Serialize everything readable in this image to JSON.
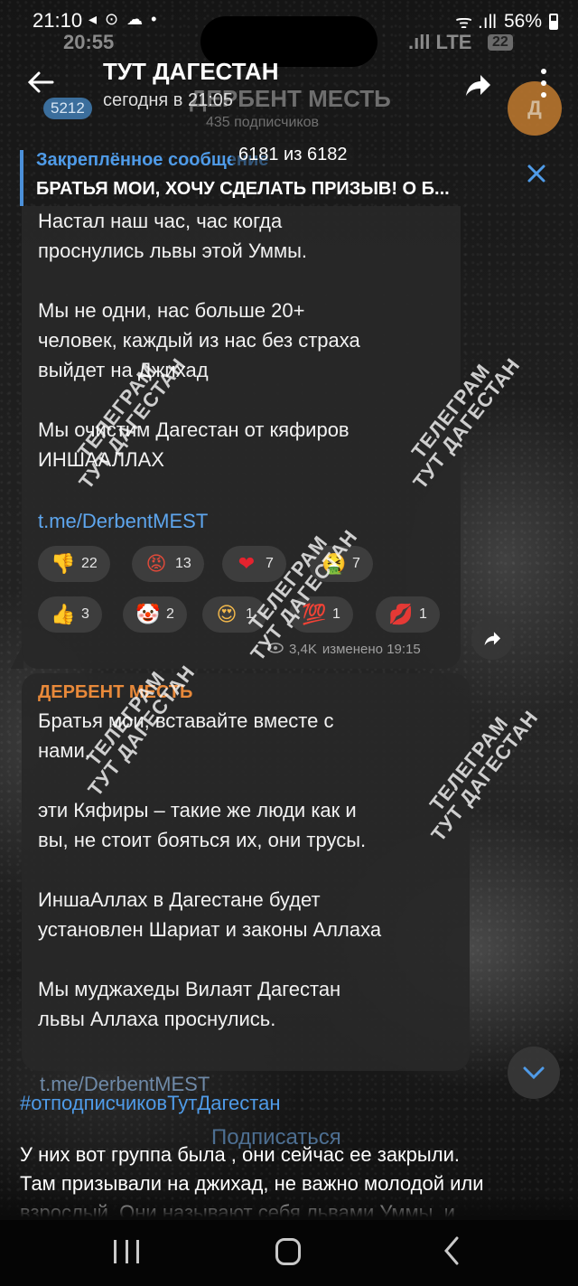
{
  "status": {
    "time": "21:10",
    "left_icons": "◂ ⊙ ☁ •",
    "signal": "ᯤ .ıll",
    "battery": "56%",
    "ghost_time": "20:55",
    "ghost_net": ".ıll LTE",
    "ghost_badge": "22"
  },
  "header": {
    "title": "ТУТ ДАГЕСТАН",
    "subtitle": "сегодня в 21:05",
    "ghost_channel": "ДЕРБЕНТ МЕСТЬ",
    "ghost_subscribers": "435 подписчиков",
    "unread_badge": "5212",
    "avatar_letter": "Д"
  },
  "pinned": {
    "label": "Закреплённое сообщение",
    "text": "БРАТЬЯ МОИ, ХОЧУ СДЕЛАТЬ ПРИЗЫВ! О Б...",
    "counter": "6181 из 6182"
  },
  "message1": {
    "text": "Настал наш час, час когда\nпроснулись львы этой Уммы.\n\nМы не одни, нас больше 20+\nчеловек, каждый из нас без страха\nвыйдет на Джихад\n\nМы очистим Дагестан от кяфиров\nИНШААЛЛАХ",
    "link": "t.me/DerbentMEST",
    "reactions": [
      {
        "emoji": "👎",
        "count": "22",
        "color": "#f2b84b"
      },
      {
        "emoji": "😡",
        "count": "13",
        "color": "#e04a3a"
      },
      {
        "emoji": "❤",
        "count": "7",
        "color": "#e5232e"
      },
      {
        "emoji": "🤮",
        "count": "7",
        "color": "#7cc243"
      },
      {
        "emoji": "👍",
        "count": "3",
        "color": "#f2b84b"
      },
      {
        "emoji": "🤡",
        "count": "2",
        "color": "#e5232e"
      },
      {
        "emoji": "😍",
        "count": "1",
        "color": "#f2b84b"
      },
      {
        "emoji": "💯",
        "count": "1",
        "color": "#e5232e"
      },
      {
        "emoji": "💋",
        "count": "1",
        "color": "#e5232e"
      }
    ],
    "views": "3,4K",
    "edited": "изменено 19:15"
  },
  "message2": {
    "author": "ДЕРБЕНТ МЕСТЬ",
    "text": "Братья мои, вставайте вместе с\nнами.\n\nэти Кяфиры – такие же люди как и\nвы, не стоит бояться их, они трусы.\n\nИншаАллах в Дагестане будет\nустановлен Шариат и законы Аллаха\n\nМы муджахеды Вилаят Дагестан\nльвы Аллаха проснулись.",
    "ghost_link": "t.me/DerbentMEST"
  },
  "watermark": {
    "line1": "ТЕЛЕГРАМ",
    "line2": "ТУТ ДАГЕСТАН"
  },
  "footer": {
    "hashtag": "#отподписчиковТутДагестан",
    "subscribe": "Подписаться",
    "caption": "У них вот группа была , они сейчас ее закрыли.\nТам призывали на джихад, не важно молодой или\nвзрослый. Они называют себя львами Уммы, и"
  },
  "colors": {
    "accent": "#4f9be8",
    "author": "#e8893a",
    "link": "#5ea6ee"
  }
}
